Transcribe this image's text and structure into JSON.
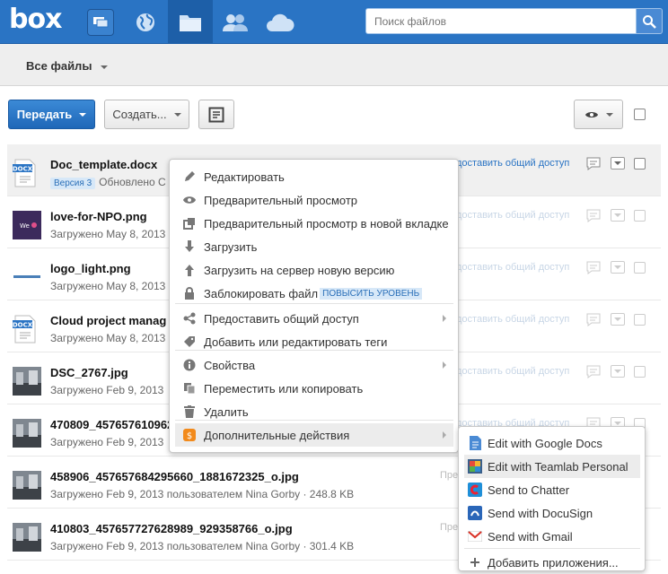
{
  "app": {
    "logo": "box"
  },
  "search": {
    "placeholder": "Поиск файлов"
  },
  "subheader": {
    "title": "Все файлы"
  },
  "toolbar": {
    "upload_label": "Передать",
    "create_label": "Создать..."
  },
  "files": [
    {
      "name": "Doc_template.docx",
      "version": "Версия 3",
      "meta": "Обновлено С",
      "share": "доставить общий доступ",
      "thumb": "docx"
    },
    {
      "name": "love-for-NPO.png",
      "meta": "Загружено May 8, 2013",
      "share": "доставить общий доступ",
      "thumb": "img-purple"
    },
    {
      "name": "logo_light.png",
      "meta": "Загружено May 8, 2013",
      "share": "доставить общий доступ",
      "thumb": "img-logo"
    },
    {
      "name": "Cloud project manag",
      "meta": "Загружено May 8, 2013",
      "share": "доставить общий доступ",
      "thumb": "docx"
    },
    {
      "name": "DSC_2767.jpg",
      "meta": "Загружено Feb 9, 2013",
      "share": "доставить общий доступ",
      "thumb": "img-photo"
    },
    {
      "name": "470809_457657610962",
      "meta": "Загружено Feb 9, 2013",
      "share": "доставить общий доступ",
      "thumb": "img-photo"
    },
    {
      "name": "458906_457657684295660_1881672325_o.jpg",
      "meta": "Загружено Feb 9, 2013 пользователем Nina Gorby · 248.8 KB",
      "share": "Пре",
      "thumb": "img-photo"
    },
    {
      "name": "410803_457657727628989_929358766_o.jpg",
      "meta": "Загружено Feb 9, 2013 пользователем Nina Gorby · 301.4 KB",
      "share": "Пре",
      "thumb": "img-photo"
    }
  ],
  "context_menu": {
    "items": [
      {
        "label": "Редактировать",
        "icon": "pencil-icon"
      },
      {
        "label": "Предварительный просмотр",
        "icon": "eye-icon"
      },
      {
        "label": "Предварительный просмотр в новой вкладке",
        "icon": "new-tab-icon"
      },
      {
        "label": "Загрузить",
        "icon": "download-icon"
      },
      {
        "label": "Загрузить на сервер новую версию",
        "icon": "upload-icon"
      },
      {
        "label": "Заблокировать файл",
        "icon": "lock-icon",
        "badge": "ПОВЫСИТЬ УРОВЕНЬ"
      },
      {
        "label": "Предоставить общий доступ",
        "icon": "share-icon"
      },
      {
        "label": "Добавить или редактировать теги",
        "icon": "tag-icon"
      },
      {
        "label": "Свойства",
        "icon": "info-icon"
      },
      {
        "label": "Переместить или копировать",
        "icon": "copy-icon"
      },
      {
        "label": "Удалить",
        "icon": "trash-icon"
      },
      {
        "label": "Дополнительные действия",
        "icon": "apps-icon"
      }
    ]
  },
  "submenu": {
    "items": [
      {
        "label": "Edit with Google Docs",
        "icon": "google-docs-icon"
      },
      {
        "label": "Edit with Teamlab Personal",
        "icon": "teamlab-icon"
      },
      {
        "label": "Send to Chatter",
        "icon": "chatter-icon"
      },
      {
        "label": "Send with DocuSign",
        "icon": "docusign-icon"
      },
      {
        "label": "Send with Gmail",
        "icon": "gmail-icon"
      },
      {
        "label": "Добавить приложения...",
        "icon": "plus-icon"
      }
    ]
  },
  "colors": {
    "brand": "#2a74c4",
    "upgrade_badge": "#d7e8f8"
  }
}
